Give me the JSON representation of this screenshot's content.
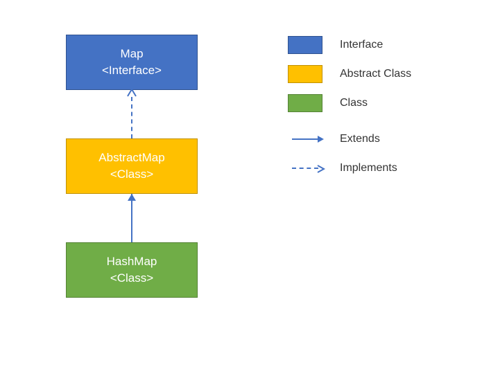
{
  "nodes": {
    "map": {
      "title": "Map",
      "stereotype": "<Interface>"
    },
    "abstractMap": {
      "title": "AbstractMap",
      "stereotype": "<Class>"
    },
    "hashMap": {
      "title": "HashMap",
      "stereotype": "<Class>"
    }
  },
  "edges": [
    {
      "from": "abstractMap",
      "to": "map",
      "kind": "implements"
    },
    {
      "from": "hashMap",
      "to": "abstractMap",
      "kind": "extends"
    }
  ],
  "legend": {
    "colors": [
      {
        "label": "Interface",
        "color": "#4472C4"
      },
      {
        "label": "Abstract Class",
        "color": "#FFC000"
      },
      {
        "label": "Class",
        "color": "#70AD47"
      }
    ],
    "arrows": [
      {
        "label": "Extends",
        "style": "solid"
      },
      {
        "label": "Implements",
        "style": "dashed"
      }
    ]
  },
  "colors": {
    "interface": "#4472C4",
    "abstractClass": "#FFC000",
    "class": "#70AD47",
    "arrow": "#4472C4"
  }
}
